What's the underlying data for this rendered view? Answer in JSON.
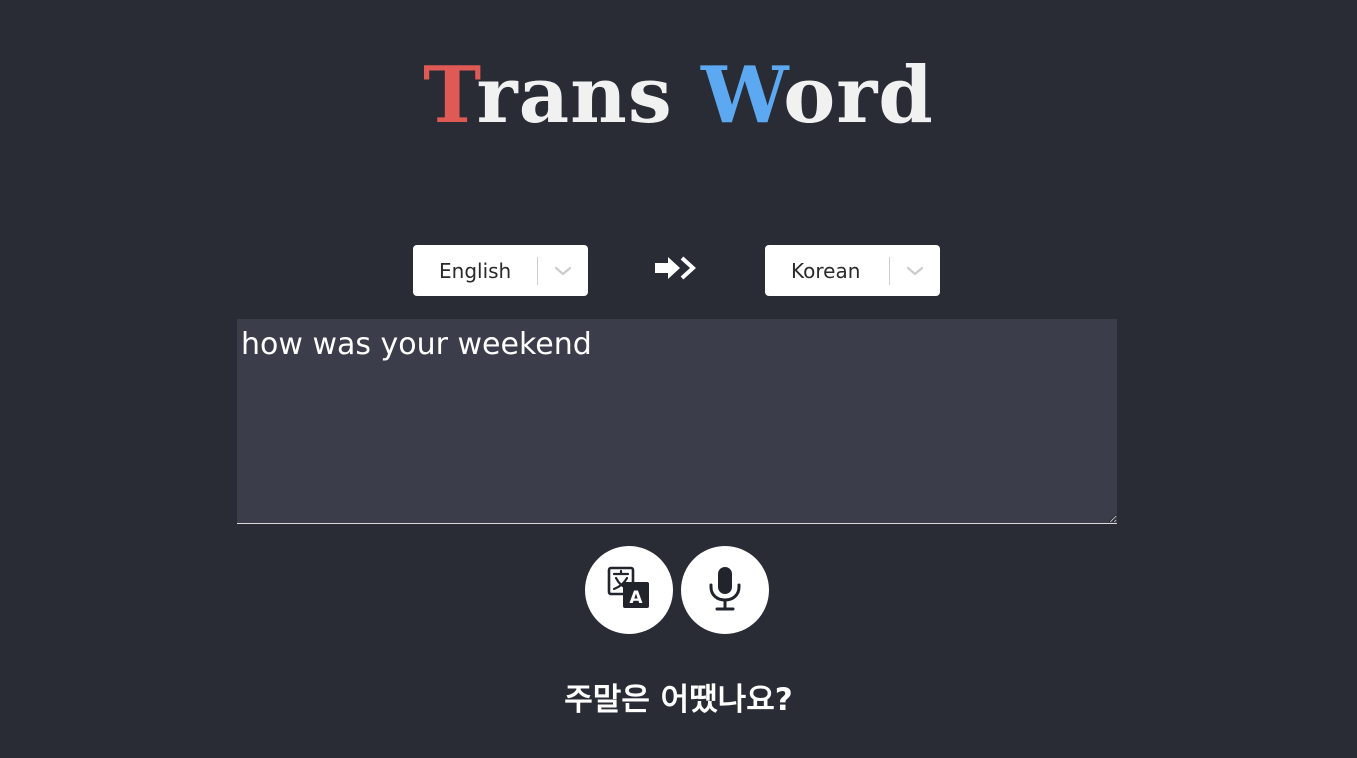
{
  "logo": {
    "first_initial": "T",
    "first_rest": "rans",
    "second_initial": "W",
    "second_rest": "ord"
  },
  "source_language": {
    "selected": "English",
    "icon": "chevron-down-icon"
  },
  "swap": {
    "icon": "double-arrow-right-icon"
  },
  "target_language": {
    "selected": "Korean",
    "icon": "chevron-down-icon"
  },
  "input": {
    "value": "how was your weekend",
    "placeholder": ""
  },
  "actions": {
    "translate_icon": "translate-icon",
    "mic_icon": "microphone-icon"
  },
  "result": {
    "text": "주말은 어땠나요?"
  },
  "colors": {
    "background": "#292b35",
    "textarea": "#3b3e4a",
    "logo_red": "#e05a55",
    "logo_blue": "#5ca9f2"
  }
}
